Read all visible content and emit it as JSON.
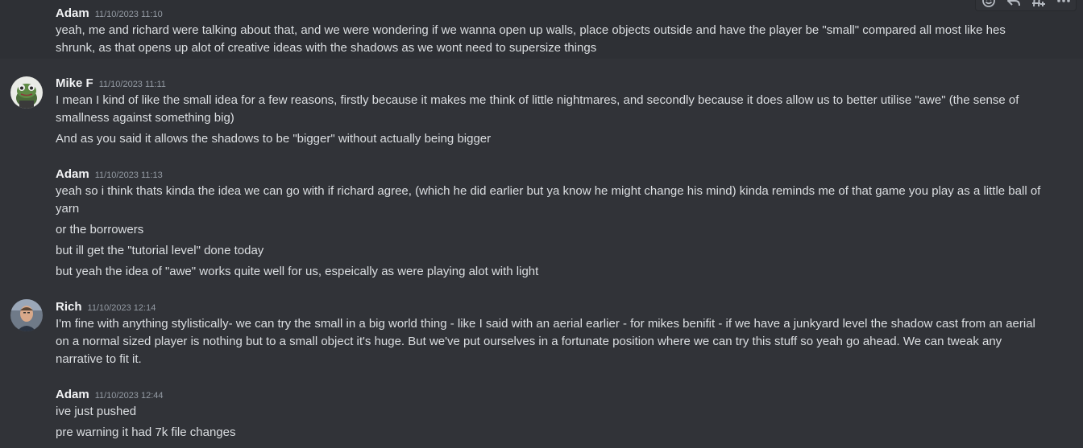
{
  "toolbar": {
    "icons": [
      "add-reaction-icon",
      "reply-icon",
      "create-thread-icon",
      "more-icon"
    ]
  },
  "messages": [
    {
      "author": "Adam",
      "timestamp": "11/10/2023 11:10",
      "lines": [
        "yeah, me and richard were talking about that, and we were wondering if we wanna open up walls, place objects outside and have the player be \"small\" compared all most like hes shrunk, as that opens up alot of creative ideas with the shadows as we wont need to supersize things"
      ]
    },
    {
      "author": "Mike F",
      "timestamp": "11/10/2023 11:11",
      "lines": [
        "I mean I kind of like the small idea for a few reasons, firstly because it makes me think of little nightmares, and secondly because it does allow us to better utilise \"awe\" (the sense of smallness against something big)",
        "And as you said it allows the shadows to be \"bigger\" without actually being bigger"
      ]
    },
    {
      "author": "Adam",
      "timestamp": "11/10/2023 11:13",
      "lines": [
        "yeah so i think thats kinda the idea we can go with if richard agree, (which he did earlier but ya know he might change his mind) kinda reminds me of that game you play as a little ball of yarn",
        "or the borrowers",
        "but ill get the \"tutorial level\" done today",
        "but yeah the idea of \"awe\" works quite well for us, espeically as were playing alot with light"
      ]
    },
    {
      "author": "Rich",
      "timestamp": "11/10/2023 12:14",
      "lines": [
        "I'm fine with anything stylistically- we can try the small in a big world thing - like I said with an aerial earlier - for mikes benifit - if we have a junkyard level the shadow cast from an aerial on a normal sized player is nothing but to a small object it's huge. But we've put ourselves in a fortunate position where we can try this stuff so yeah go ahead. We can tweak any narrative to fit it."
      ]
    },
    {
      "author": "Adam",
      "timestamp": "11/10/2023 12:44",
      "lines": [
        "ive just pushed",
        "pre warning it had 7k file changes"
      ]
    }
  ]
}
